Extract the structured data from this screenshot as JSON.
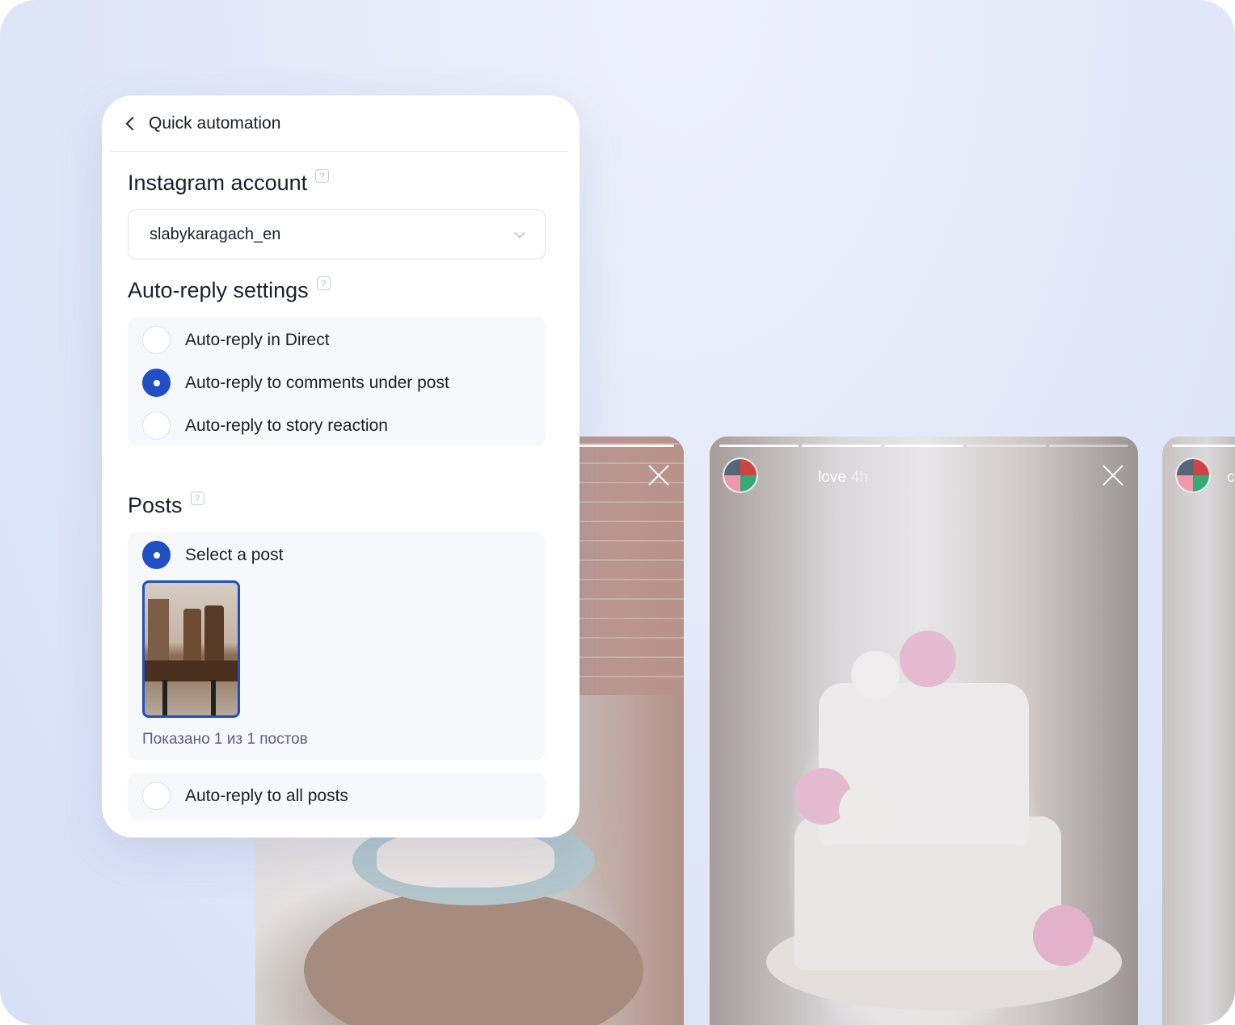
{
  "panel": {
    "title": "Quick automation",
    "instagram_section": {
      "title": "Instagram account",
      "selected_account": "slabykaragach_en"
    },
    "autoreply_section": {
      "title": "Auto-reply settings",
      "options": [
        {
          "label": "Auto-reply in Direct",
          "checked": false
        },
        {
          "label": "Auto-reply to comments under post",
          "checked": true
        },
        {
          "label": "Auto-reply to story reaction",
          "checked": false
        }
      ]
    },
    "posts_section": {
      "title": "Posts",
      "select_post_label": "Select a post",
      "count_text": "Показано 1 из 1 постов",
      "all_posts_label": "Auto-reply to all posts"
    },
    "help_glyph": "?"
  },
  "stories": {
    "middle_user": "love",
    "middle_time": "4h",
    "right_user_initial": "c"
  },
  "colors": {
    "accent": "#1f4fc2",
    "background": "#e3e9f8",
    "text": "#1c1f2b",
    "muted_text": "#5a6180"
  },
  "icons": [
    "back-chevron-icon",
    "help-icon",
    "chevron-down-icon",
    "close-icon",
    "avatar"
  ]
}
